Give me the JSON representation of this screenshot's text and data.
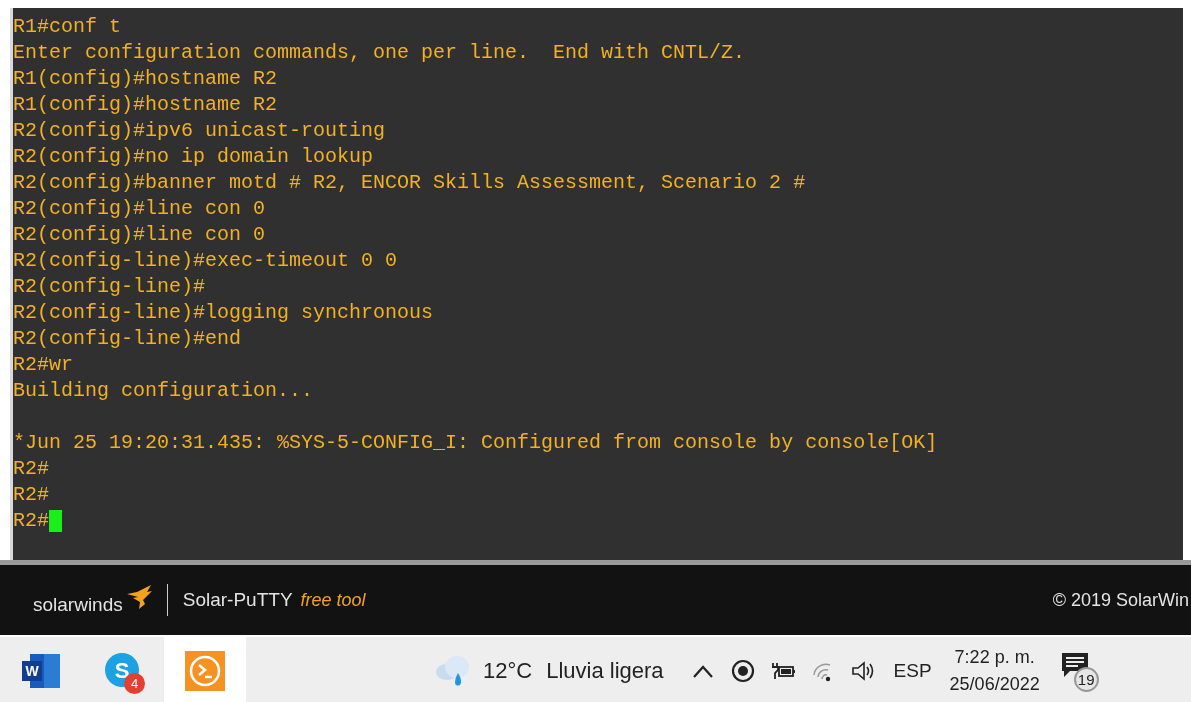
{
  "terminal": {
    "lines": [
      {
        "kind": "text",
        "text": "R1#conf t"
      },
      {
        "kind": "text",
        "text": "Enter configuration commands, one per line.  End with CNTL/Z."
      },
      {
        "kind": "text",
        "text": "R1(config)#hostname R2"
      },
      {
        "kind": "text",
        "text": "R1(config)#hostname R2"
      },
      {
        "kind": "text",
        "text": "R2(config)#ipv6 unicast-routing"
      },
      {
        "kind": "text",
        "text": "R2(config)#no ip domain lookup"
      },
      {
        "kind": "text",
        "text": "R2(config)#banner motd # R2, ENCOR Skills Assessment, Scenario 2 #"
      },
      {
        "kind": "text",
        "text": "R2(config)#line con 0"
      },
      {
        "kind": "text",
        "text": "R2(config)#line con 0"
      },
      {
        "kind": "text",
        "text": "R2(config-line)#exec-timeout 0 0"
      },
      {
        "kind": "text",
        "text": "R2(config-line)#"
      },
      {
        "kind": "text",
        "text": "R2(config-line)#logging synchronous"
      },
      {
        "kind": "text",
        "text": "R2(config-line)#end"
      },
      {
        "kind": "text",
        "text": "R2#wr"
      },
      {
        "kind": "text",
        "text": "Building configuration..."
      },
      {
        "kind": "blank"
      },
      {
        "kind": "text",
        "text": "*Jun 25 19:20:31.435: %SYS-5-CONFIG_I: Configured from console by console[OK]"
      },
      {
        "kind": "text",
        "text": "R2#"
      },
      {
        "kind": "text",
        "text": "R2#"
      },
      {
        "kind": "text",
        "text": "R2#"
      }
    ],
    "cursor_visible": true
  },
  "footer": {
    "brand": "solarwinds",
    "product": "Solar-PuTTY",
    "tagline": "free tool",
    "copyright": "© 2019 SolarWin"
  },
  "taskbar": {
    "apps": [
      {
        "kind": "word",
        "label": "W",
        "selected": false
      },
      {
        "kind": "skype",
        "label": "S",
        "badge": "4",
        "selected": false
      },
      {
        "kind": "putty",
        "selected": true
      }
    ],
    "weather": {
      "temperature": "12°C",
      "condition": "Lluvia ligera"
    },
    "language": "ESP",
    "time": "7:22 p. m.",
    "date": "25/06/2022",
    "notifications": "19"
  }
}
